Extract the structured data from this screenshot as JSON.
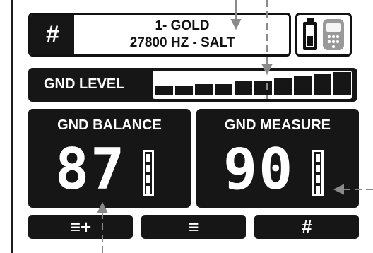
{
  "program": {
    "hash_symbol": "#",
    "line1": "1- GOLD",
    "line2": "27800 HZ - SALT"
  },
  "status": {
    "battery_icon": "battery-icon",
    "device_icon": "detector-remote-icon"
  },
  "gnd_level": {
    "label": "GND LEVEL",
    "bar_count": 10,
    "bar_heights": [
      0.35,
      0.35,
      0.45,
      0.45,
      0.55,
      0.6,
      0.7,
      0.75,
      0.85,
      0.95
    ]
  },
  "gnd_balance": {
    "title": "GND BALANCE",
    "value": "87"
  },
  "gnd_measure": {
    "title": "GND MEASURE",
    "value": "90"
  },
  "buttons": {
    "menu_plus": "≡+",
    "menu": "≡",
    "hash": "#"
  },
  "colors": {
    "panel_bg": "#161616",
    "text_on_panel": "#ffffff",
    "guide": "#8a8a8a"
  }
}
